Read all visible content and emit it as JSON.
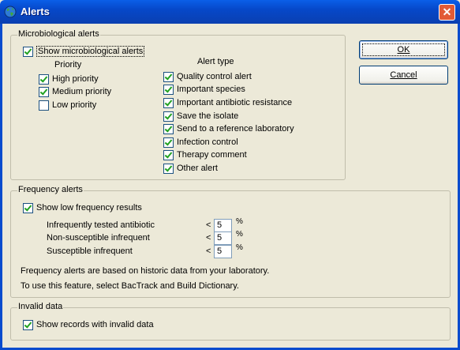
{
  "window": {
    "title": "Alerts",
    "close_label": "✕",
    "icon": "globe-icon"
  },
  "buttons": {
    "ok": "OK",
    "cancel": "Cancel"
  },
  "microbiological": {
    "legend": "Microbiological alerts",
    "show": {
      "label": "Show microbiological alerts",
      "checked": true
    },
    "priority_header": "Priority",
    "priorities": [
      {
        "label": "High priority",
        "checked": true
      },
      {
        "label": "Medium priority",
        "checked": true
      },
      {
        "label": "Low priority",
        "checked": false
      }
    ],
    "alert_type_header": "Alert type",
    "alert_types": [
      {
        "label": "Quality control alert",
        "checked": true
      },
      {
        "label": "Important species",
        "checked": true
      },
      {
        "label": "Important antibiotic resistance",
        "checked": true
      },
      {
        "label": "Save the isolate",
        "checked": true
      },
      {
        "label": "Send to a reference laboratory",
        "checked": true
      },
      {
        "label": "Infection control",
        "checked": true
      },
      {
        "label": "Therapy comment",
        "checked": true
      },
      {
        "label": "Other alert",
        "checked": true
      }
    ]
  },
  "frequency": {
    "legend": "Frequency alerts",
    "show": {
      "label": "Show low frequency results",
      "checked": true
    },
    "thresholds": [
      {
        "label": "Infrequently tested antibiotic",
        "op": "<",
        "value": "5",
        "unit": "%"
      },
      {
        "label": "Non-susceptible infrequent",
        "op": "<",
        "value": "5",
        "unit": "%"
      },
      {
        "label": "Susceptible infrequent",
        "op": "<",
        "value": "5",
        "unit": "%"
      }
    ],
    "note1": "Frequency alerts are based on historic data from your laboratory.",
    "note2": "To use this feature, select BacTrack and Build Dictionary."
  },
  "invalid": {
    "legend": "Invalid data",
    "show": {
      "label": "Show records with invalid data",
      "checked": true
    }
  }
}
